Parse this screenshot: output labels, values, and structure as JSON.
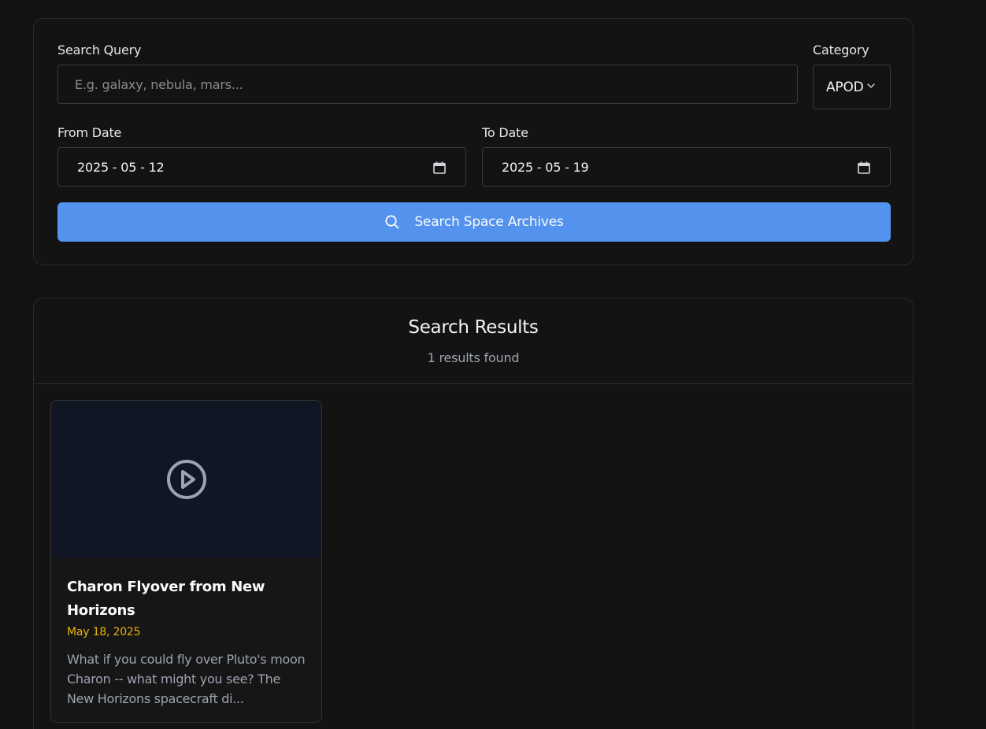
{
  "search_form": {
    "query_label": "Search Query",
    "query_placeholder": "E.g. galaxy, nebula, mars...",
    "category_label": "Category",
    "category_value": "APOD",
    "from_label": "From Date",
    "from_value": "2025 - 05 - 12",
    "to_label": "To Date",
    "to_value": "2025 - 05 - 19",
    "search_button_label": "Search Space Archives"
  },
  "results": {
    "title": "Search Results",
    "count_text": "1 results found",
    "items": [
      {
        "title": "Charon Flyover from New Horizons",
        "date": "May 18, 2025",
        "description": "What if you could fly over Pluto's moon Charon -- what might you see? The New Horizons spacecraft di...",
        "media_icon": "play-circle-icon"
      }
    ]
  },
  "colors": {
    "background": "#121212",
    "primary_button": "#5393ed",
    "date_accent": "#eab308",
    "thumbnail_bg": "#101624"
  }
}
